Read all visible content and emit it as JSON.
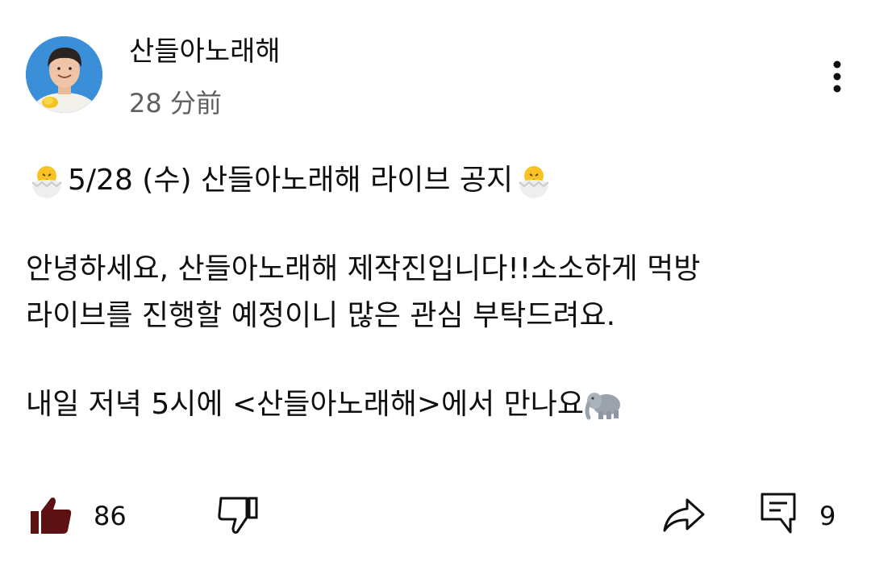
{
  "header": {
    "channel_name": "산들아노래해",
    "time_ago": "28 分前"
  },
  "post": {
    "title_line": "5/28 (수) 산들아노래해 라이브 공지",
    "paragraph1_line1": "안녕하세요, 산들아노래해 제작진입니다!!소소하게 먹방",
    "paragraph1_line2": "라이브를 진행할 예정이니 많은 관심 부탁드려요.",
    "paragraph2": "내일 저녁 5시에 <산들아노래해>에서 만나요"
  },
  "actions": {
    "like_count": "86",
    "comment_count": "9"
  },
  "icons": {
    "title_emoji": "hatching-chick-icon",
    "end_emoji": "elephant-icon",
    "like": "thumbs-up-filled-icon",
    "dislike": "thumbs-down-icon",
    "share": "share-icon",
    "comment": "comment-icon",
    "more": "more-vertical-icon"
  },
  "colors": {
    "text": "#0f0f0f",
    "secondary_text": "#606060",
    "like_filled": "#5c1212"
  }
}
